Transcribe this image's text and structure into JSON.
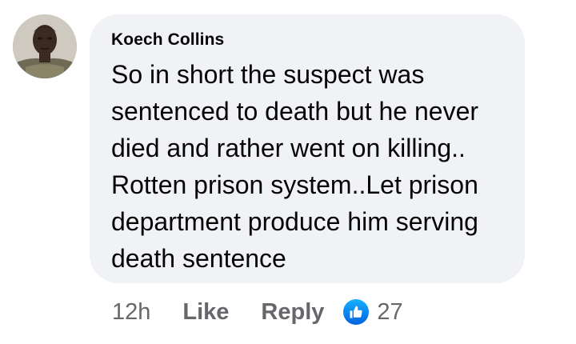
{
  "comment": {
    "author": "Koech Collins",
    "text": "So in short the suspect was sentenced to death but he never died and rather went on killing.. Rotten prison system..Let prison department produce him serving death sentence",
    "avatar_icon": "user-avatar"
  },
  "actions": {
    "time": "12h",
    "like_label": "Like",
    "reply_label": "Reply",
    "reaction_icon": "thumbs-up-icon",
    "reaction_count": "27"
  },
  "colors": {
    "bubble": "#f0f2f5",
    "text": "#050505",
    "muted": "#65676b",
    "like_blue": "#0866ff"
  }
}
